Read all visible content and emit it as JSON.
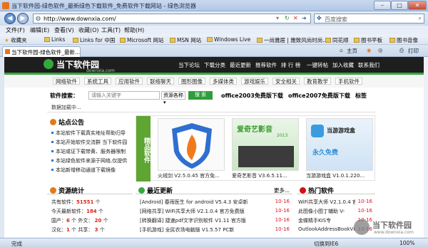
{
  "window": {
    "title": "当下软件园-绿色软件_最新绿色下载软件_免费软件下载网站 - 绿色浏览器",
    "min": "–",
    "max": "□",
    "close": "✕"
  },
  "address": {
    "url": "http://www.downxia.com/",
    "search_placeholder": "百度搜索"
  },
  "menu": [
    "文件(F)",
    "编辑(E)",
    "查看(V)",
    "收藏(O)",
    "工具(T)",
    "帮助(H)"
  ],
  "favorites": {
    "label": "收藏夹",
    "items": [
      "Links",
      "Links for 中国",
      "Microsoft 网站",
      "MSN 网站",
      "Windows Live",
      "一尚雅居 | 雅致风尚时尚...",
      "同花顺",
      "图书平板",
      "图书音像"
    ]
  },
  "tab": {
    "title": "当下软件园-绿色软件_最新..."
  },
  "toolbar": {
    "home": "主页",
    "rss": "",
    "print": "打印"
  },
  "site": {
    "logo": "当下软件园",
    "logo_sub": "downxia.com",
    "nav": [
      "当下论坛",
      "下载分类",
      "最近更新",
      "推荐软件",
      "排 行 榜",
      "一键转帖",
      "加入收藏",
      "联系我们"
    ],
    "cats": [
      "网络软件",
      "系统工具",
      "应用软件",
      "联络聊天",
      "图形图像",
      "多媒体类",
      "游戏娱乐",
      "安全相关",
      "教育教学",
      "手机软件"
    ],
    "search_label": "软件搜索：",
    "search_placeholder": "请输入关键字",
    "search_select": "资源各称",
    "search_button": "搜 索",
    "hot1": "office2003免费版下载",
    "hot2": "office2007免费版下载",
    "hot3": "标签",
    "loading": "数据加载中..."
  },
  "announce": {
    "title": "站点公告",
    "items": [
      "本站软件下载真实地址帮助归导",
      "本站开始软件交流群 当下软件园",
      "本站或证下载带黄、服务器限制",
      "本站绿色软件来源于网络,仅提供",
      "本站新增移动通道下载镜像"
    ]
  },
  "featured": {
    "vertical": "精品软件",
    "items": [
      {
        "caption": "火绒剑 V2.5.0.45 官方免..."
      },
      {
        "caption": "爱奇艺影音 V3.6.5.11..."
      },
      {
        "caption": "当游游戏盒 V1.0.1.220..."
      }
    ],
    "aiqiyi_text": "爱奇艺影音",
    "aiqiyi_year": "2013",
    "dangyou_text": "当游游戏盒",
    "dangyou_sub": "永久免费"
  },
  "stats": {
    "title": "资源统计",
    "rows": [
      {
        "label": "共有软件：",
        "value": "51551",
        "unit": "个"
      },
      {
        "label": "今天最新软件：",
        "value": "184",
        "unit": "个"
      },
      {
        "label": "国产：",
        "value": "6",
        "unit": "个  外文：",
        "value2": "20",
        "unit2": "个"
      },
      {
        "label": "汉化：",
        "value": "1",
        "unit": "个  共享：",
        "value2": "3",
        "unit2": "个"
      }
    ]
  },
  "latest": {
    "title": "最近更新",
    "more": "更多...",
    "rows": [
      {
        "text": "[Android] 春雨医生 for android V5.4.3 安卓新",
        "date": "10-16"
      },
      {
        "text": "[网络共享] WiFi共享大师 V2.1.0.4 官方免费版",
        "date": "10-16"
      },
      {
        "text": "[转换翻译] 捷速pdf文字识别软件 V1.11 官方版",
        "date": "10-16"
      },
      {
        "text": "[手机游戏] 全民农场电脑版 V1.5.57 PC新",
        "date": "10-16"
      }
    ]
  },
  "hot": {
    "title": "热门软件",
    "rows": [
      {
        "text": "WiFi共享大师 V2.1.0.4 官",
        "date": "10-16"
      },
      {
        "text": "此图像小图丁辅助 V-",
        "date": "10-16"
      },
      {
        "text": "金蝶精手KIS专",
        "date": "10-16"
      },
      {
        "text": "OutlookAddressBookVie",
        "date": "10-16"
      }
    ]
  },
  "status": {
    "left": "完成",
    "mode": "切换到IE6",
    "zoom": "100%"
  },
  "watermark": {
    "text": "当下软件园",
    "sub": "www.downxia.com"
  },
  "colors": {
    "site_green": "#37a73d",
    "header_dark": "#1e1e1e",
    "title_gradient": "#b2c8e6",
    "accent_red": "#d21111"
  }
}
